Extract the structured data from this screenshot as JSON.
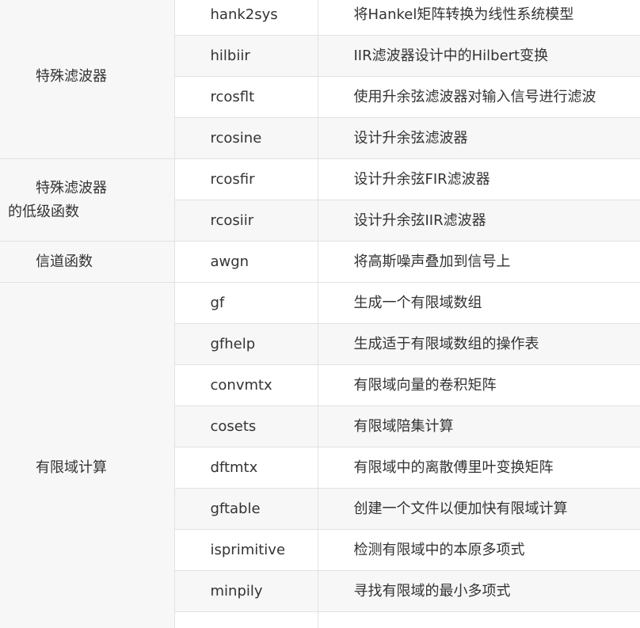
{
  "groups": [
    {
      "category": "特殊滤波器",
      "rows": [
        {
          "fn": "hank2sys",
          "desc": "将Hankel矩阵转换为线性系统模型"
        },
        {
          "fn": "hilbiir",
          "desc": "IIR滤波器设计中的Hilbert变换"
        },
        {
          "fn": "rcosflt",
          "desc": "使用升余弦滤波器对输入信号进行滤波"
        },
        {
          "fn": "rcosine",
          "desc": "设计升余弦滤波器"
        }
      ]
    },
    {
      "category": "特殊滤波器的低级函数",
      "rows": [
        {
          "fn": "rcosfir",
          "desc": "设计升余弦FIR滤波器"
        },
        {
          "fn": "rcosiir",
          "desc": "设计升余弦IIR滤波器"
        }
      ]
    },
    {
      "category": "信道函数",
      "rows": [
        {
          "fn": "awgn",
          "desc": "将高斯噪声叠加到信号上"
        }
      ]
    },
    {
      "category": "有限域计算",
      "rows": [
        {
          "fn": "gf",
          "desc": "生成一个有限域数组"
        },
        {
          "fn": "gfhelp",
          "desc": "生成适于有限域数组的操作表"
        },
        {
          "fn": "convmtx",
          "desc": "有限域向量的卷积矩阵"
        },
        {
          "fn": "cosets",
          "desc": "有限域陪集计算"
        },
        {
          "fn": "dftmtx",
          "desc": "有限域中的离散傅里叶变换矩阵"
        },
        {
          "fn": "gftable",
          "desc": "创建一个文件以便加快有限域计算"
        },
        {
          "fn": "isprimitive",
          "desc": "检测有限域中的本原多项式"
        },
        {
          "fn": "minpily",
          "desc": "寻找有限域的最小多项式"
        },
        {
          "fn": "",
          "desc": ""
        }
      ]
    }
  ]
}
